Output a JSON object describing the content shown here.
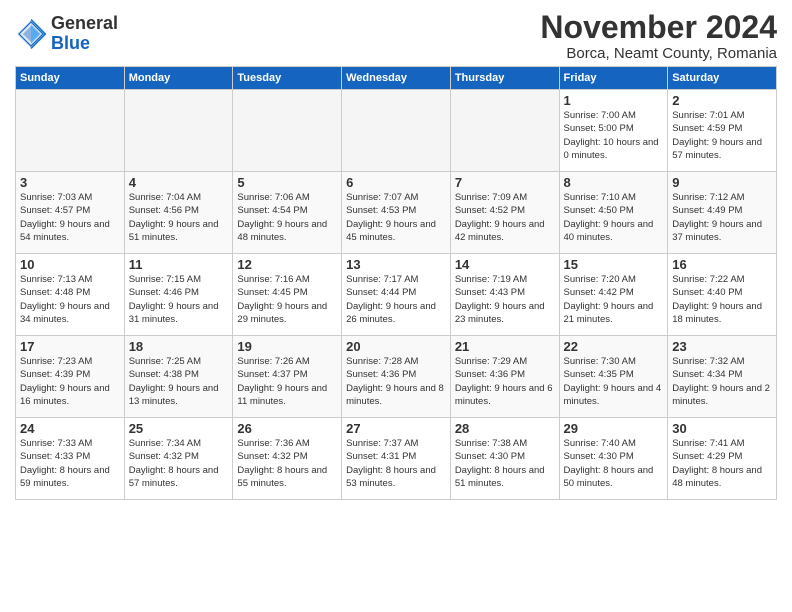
{
  "header": {
    "logo_general": "General",
    "logo_blue": "Blue",
    "month_title": "November 2024",
    "subtitle": "Borca, Neamt County, Romania"
  },
  "days_of_week": [
    "Sunday",
    "Monday",
    "Tuesday",
    "Wednesday",
    "Thursday",
    "Friday",
    "Saturday"
  ],
  "weeks": [
    [
      {
        "day": "",
        "empty": true
      },
      {
        "day": "",
        "empty": true
      },
      {
        "day": "",
        "empty": true
      },
      {
        "day": "",
        "empty": true
      },
      {
        "day": "",
        "empty": true
      },
      {
        "day": "1",
        "sunrise": "Sunrise: 7:00 AM",
        "sunset": "Sunset: 5:00 PM",
        "daylight": "Daylight: 10 hours and 0 minutes."
      },
      {
        "day": "2",
        "sunrise": "Sunrise: 7:01 AM",
        "sunset": "Sunset: 4:59 PM",
        "daylight": "Daylight: 9 hours and 57 minutes."
      }
    ],
    [
      {
        "day": "3",
        "sunrise": "Sunrise: 7:03 AM",
        "sunset": "Sunset: 4:57 PM",
        "daylight": "Daylight: 9 hours and 54 minutes."
      },
      {
        "day": "4",
        "sunrise": "Sunrise: 7:04 AM",
        "sunset": "Sunset: 4:56 PM",
        "daylight": "Daylight: 9 hours and 51 minutes."
      },
      {
        "day": "5",
        "sunrise": "Sunrise: 7:06 AM",
        "sunset": "Sunset: 4:54 PM",
        "daylight": "Daylight: 9 hours and 48 minutes."
      },
      {
        "day": "6",
        "sunrise": "Sunrise: 7:07 AM",
        "sunset": "Sunset: 4:53 PM",
        "daylight": "Daylight: 9 hours and 45 minutes."
      },
      {
        "day": "7",
        "sunrise": "Sunrise: 7:09 AM",
        "sunset": "Sunset: 4:52 PM",
        "daylight": "Daylight: 9 hours and 42 minutes."
      },
      {
        "day": "8",
        "sunrise": "Sunrise: 7:10 AM",
        "sunset": "Sunset: 4:50 PM",
        "daylight": "Daylight: 9 hours and 40 minutes."
      },
      {
        "day": "9",
        "sunrise": "Sunrise: 7:12 AM",
        "sunset": "Sunset: 4:49 PM",
        "daylight": "Daylight: 9 hours and 37 minutes."
      }
    ],
    [
      {
        "day": "10",
        "sunrise": "Sunrise: 7:13 AM",
        "sunset": "Sunset: 4:48 PM",
        "daylight": "Daylight: 9 hours and 34 minutes."
      },
      {
        "day": "11",
        "sunrise": "Sunrise: 7:15 AM",
        "sunset": "Sunset: 4:46 PM",
        "daylight": "Daylight: 9 hours and 31 minutes."
      },
      {
        "day": "12",
        "sunrise": "Sunrise: 7:16 AM",
        "sunset": "Sunset: 4:45 PM",
        "daylight": "Daylight: 9 hours and 29 minutes."
      },
      {
        "day": "13",
        "sunrise": "Sunrise: 7:17 AM",
        "sunset": "Sunset: 4:44 PM",
        "daylight": "Daylight: 9 hours and 26 minutes."
      },
      {
        "day": "14",
        "sunrise": "Sunrise: 7:19 AM",
        "sunset": "Sunset: 4:43 PM",
        "daylight": "Daylight: 9 hours and 23 minutes."
      },
      {
        "day": "15",
        "sunrise": "Sunrise: 7:20 AM",
        "sunset": "Sunset: 4:42 PM",
        "daylight": "Daylight: 9 hours and 21 minutes."
      },
      {
        "day": "16",
        "sunrise": "Sunrise: 7:22 AM",
        "sunset": "Sunset: 4:40 PM",
        "daylight": "Daylight: 9 hours and 18 minutes."
      }
    ],
    [
      {
        "day": "17",
        "sunrise": "Sunrise: 7:23 AM",
        "sunset": "Sunset: 4:39 PM",
        "daylight": "Daylight: 9 hours and 16 minutes."
      },
      {
        "day": "18",
        "sunrise": "Sunrise: 7:25 AM",
        "sunset": "Sunset: 4:38 PM",
        "daylight": "Daylight: 9 hours and 13 minutes."
      },
      {
        "day": "19",
        "sunrise": "Sunrise: 7:26 AM",
        "sunset": "Sunset: 4:37 PM",
        "daylight": "Daylight: 9 hours and 11 minutes."
      },
      {
        "day": "20",
        "sunrise": "Sunrise: 7:28 AM",
        "sunset": "Sunset: 4:36 PM",
        "daylight": "Daylight: 9 hours and 8 minutes."
      },
      {
        "day": "21",
        "sunrise": "Sunrise: 7:29 AM",
        "sunset": "Sunset: 4:36 PM",
        "daylight": "Daylight: 9 hours and 6 minutes."
      },
      {
        "day": "22",
        "sunrise": "Sunrise: 7:30 AM",
        "sunset": "Sunset: 4:35 PM",
        "daylight": "Daylight: 9 hours and 4 minutes."
      },
      {
        "day": "23",
        "sunrise": "Sunrise: 7:32 AM",
        "sunset": "Sunset: 4:34 PM",
        "daylight": "Daylight: 9 hours and 2 minutes."
      }
    ],
    [
      {
        "day": "24",
        "sunrise": "Sunrise: 7:33 AM",
        "sunset": "Sunset: 4:33 PM",
        "daylight": "Daylight: 8 hours and 59 minutes."
      },
      {
        "day": "25",
        "sunrise": "Sunrise: 7:34 AM",
        "sunset": "Sunset: 4:32 PM",
        "daylight": "Daylight: 8 hours and 57 minutes."
      },
      {
        "day": "26",
        "sunrise": "Sunrise: 7:36 AM",
        "sunset": "Sunset: 4:32 PM",
        "daylight": "Daylight: 8 hours and 55 minutes."
      },
      {
        "day": "27",
        "sunrise": "Sunrise: 7:37 AM",
        "sunset": "Sunset: 4:31 PM",
        "daylight": "Daylight: 8 hours and 53 minutes."
      },
      {
        "day": "28",
        "sunrise": "Sunrise: 7:38 AM",
        "sunset": "Sunset: 4:30 PM",
        "daylight": "Daylight: 8 hours and 51 minutes."
      },
      {
        "day": "29",
        "sunrise": "Sunrise: 7:40 AM",
        "sunset": "Sunset: 4:30 PM",
        "daylight": "Daylight: 8 hours and 50 minutes."
      },
      {
        "day": "30",
        "sunrise": "Sunrise: 7:41 AM",
        "sunset": "Sunset: 4:29 PM",
        "daylight": "Daylight: 8 hours and 48 minutes."
      }
    ]
  ]
}
